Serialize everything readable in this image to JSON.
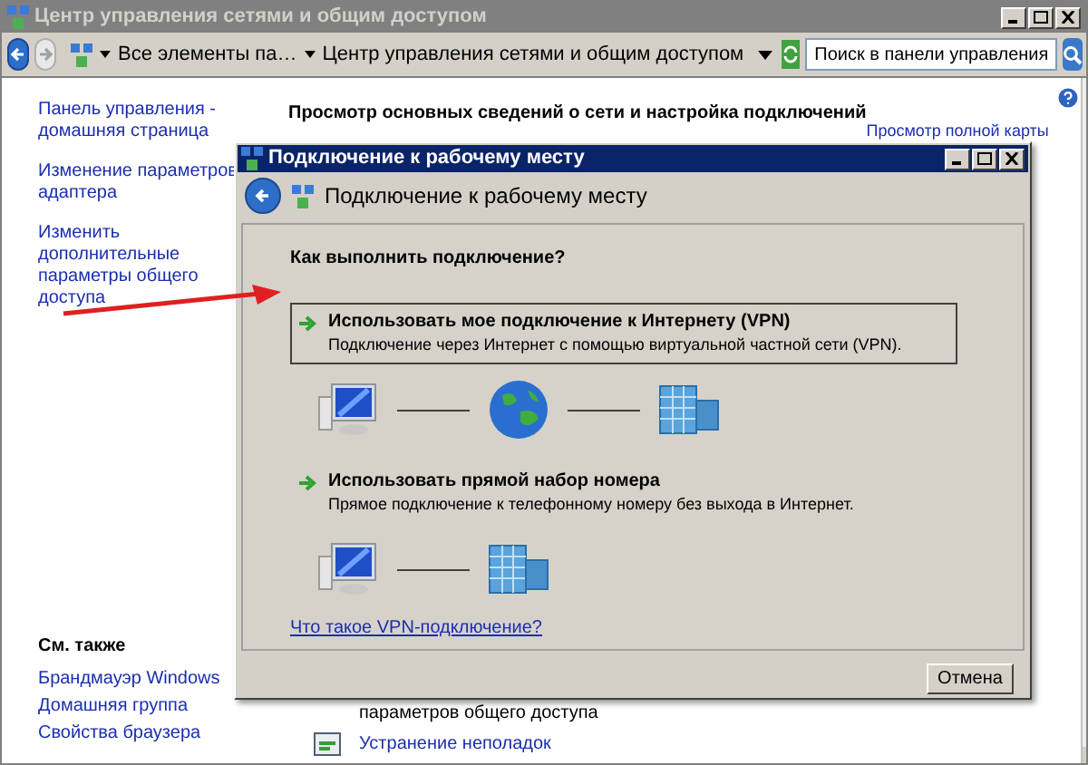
{
  "window": {
    "title": "Центр управления сетями и общим доступом"
  },
  "nav": [
    {
      "kind": "back",
      "disabled": false
    },
    {
      "kind": "forward",
      "disabled": true
    }
  ],
  "breadcrumbs": [
    "Все элементы па…",
    "Центр управления сетями и общим доступом"
  ],
  "search": {
    "placeholder": "Поиск в панели управления"
  },
  "sidebar": {
    "links": [
      "Панель управления - домашняя страница",
      "Изменение параметров адаптера",
      "Изменить дополнительные параметры общего доступа"
    ],
    "see_also_title": "См. также",
    "see_also": [
      "Брандмауэр Windows",
      "Домашняя группа",
      "Свойства браузера"
    ]
  },
  "main": {
    "heading": "Просмотр основных сведений о сети и настройка подключений",
    "map_link": "Просмотр полной карты",
    "sharing_text": "параметров общего доступа",
    "troubleshoot_link": "Устранение неполадок"
  },
  "dialog": {
    "title": "Подключение к рабочему месту",
    "header": "Подключение к рабочему месту",
    "question": "Как выполнить подключение?",
    "options": [
      {
        "title": "Использовать мое подключение к Интернету (VPN)",
        "description": "Подключение через Интернет с помощью виртуальной частной сети (VPN).",
        "selected": true,
        "diagram": [
          {
            "kind": "computer"
          },
          {
            "kind": "globe"
          },
          {
            "kind": "server"
          }
        ]
      },
      {
        "title": "Использовать прямой набор номера",
        "description": "Прямое подключение к телефонному номеру без выхода в Интернет.",
        "selected": false,
        "diagram": [
          {
            "kind": "computer"
          },
          {
            "kind": "server"
          }
        ]
      }
    ],
    "link": "Что такое VPN-подключение?",
    "cancel": "Отмена"
  }
}
